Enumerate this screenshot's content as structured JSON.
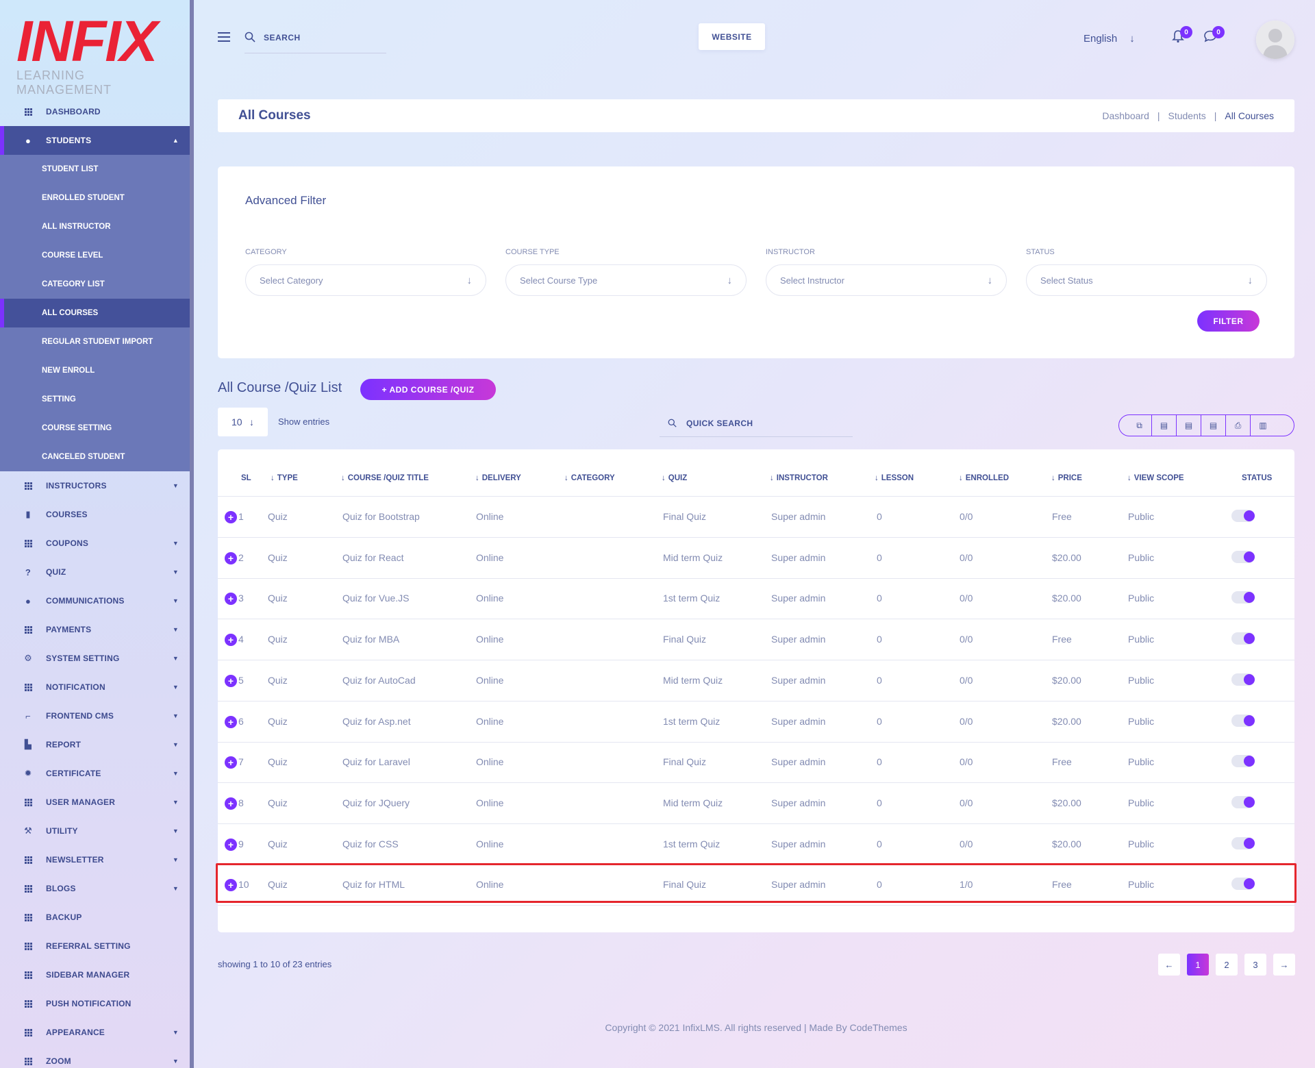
{
  "brand": {
    "logo_text": "INFIX",
    "logo_sub": "LEARNING MANAGEMENT",
    "logo_color": "#ea2235"
  },
  "sidebar": {
    "items_top": [
      {
        "label": "DASHBOARD",
        "icon": "grid-icon"
      },
      {
        "label": "STUDENTS",
        "icon": "user-icon",
        "active": true,
        "expanded": true
      }
    ],
    "submenu": [
      {
        "label": "STUDENT LIST"
      },
      {
        "label": "ENROLLED STUDENT"
      },
      {
        "label": "ALL INSTRUCTOR"
      },
      {
        "label": "COURSE LEVEL"
      },
      {
        "label": "CATEGORY LIST"
      },
      {
        "label": "ALL COURSES",
        "active": true
      },
      {
        "label": "REGULAR STUDENT IMPORT"
      },
      {
        "label": "NEW ENROLL"
      },
      {
        "label": "SETTING"
      },
      {
        "label": "COURSE SETTING"
      },
      {
        "label": "CANCELED STUDENT"
      }
    ],
    "items_bottom": [
      {
        "label": "INSTRUCTORS",
        "icon": "grid-icon",
        "caret": true
      },
      {
        "label": "COURSES",
        "icon": "book-icon",
        "caret": false
      },
      {
        "label": "COUPONS",
        "icon": "grid-icon",
        "caret": true
      },
      {
        "label": "QUIZ",
        "icon": "question-icon",
        "caret": true
      },
      {
        "label": "COMMUNICATIONS",
        "icon": "chat-icon",
        "caret": true
      },
      {
        "label": "PAYMENTS",
        "icon": "grid-icon",
        "caret": true
      },
      {
        "label": "SYSTEM SETTING",
        "icon": "gears-icon",
        "caret": true
      },
      {
        "label": "NOTIFICATION",
        "icon": "grid-icon",
        "caret": true
      },
      {
        "label": "FRONTEND CMS",
        "icon": "paint-roller-icon",
        "caret": true
      },
      {
        "label": "REPORT",
        "icon": "chart-icon",
        "caret": true
      },
      {
        "label": "CERTIFICATE",
        "icon": "certificate-icon",
        "caret": true
      },
      {
        "label": "USER MANAGER",
        "icon": "grid-icon",
        "caret": true
      },
      {
        "label": "UTILITY",
        "icon": "hammer-icon",
        "caret": true
      },
      {
        "label": "NEWSLETTER",
        "icon": "grid-icon",
        "caret": true
      },
      {
        "label": "BLOGS",
        "icon": "grid-icon",
        "caret": true
      },
      {
        "label": "BACKUP",
        "icon": "grid-icon",
        "caret": false
      },
      {
        "label": "REFERRAL SETTING",
        "icon": "grid-icon",
        "caret": false
      },
      {
        "label": "SIDEBAR MANAGER",
        "icon": "grid-icon",
        "caret": false
      },
      {
        "label": "PUSH NOTIFICATION",
        "icon": "grid-icon",
        "caret": false
      },
      {
        "label": "APPEARANCE",
        "icon": "grid-icon",
        "caret": true
      },
      {
        "label": "ZOOM",
        "icon": "grid-icon",
        "caret": true
      }
    ]
  },
  "topbar": {
    "search_placeholder": "SEARCH",
    "website_label": "WEBSITE",
    "language": "English",
    "notifications_count": "0",
    "messages_count": "0"
  },
  "page": {
    "title": "All Courses",
    "breadcrumb": [
      "Dashboard",
      "Students",
      "All Courses"
    ]
  },
  "filter": {
    "title": "Advanced Filter",
    "fields": [
      {
        "label": "CATEGORY",
        "placeholder": "Select Category"
      },
      {
        "label": "COURSE TYPE",
        "placeholder": "Select Course Type"
      },
      {
        "label": "INSTRUCTOR",
        "placeholder": "Select Instructor"
      },
      {
        "label": "STATUS",
        "placeholder": "Select Status"
      }
    ],
    "button": "FILTER"
  },
  "list": {
    "title": "All Course /Quiz List",
    "add_button": "+ ADD COURSE /QUIZ",
    "entries_value": "10",
    "show_entries": "Show entries",
    "quick_search": "QUICK SEARCH",
    "export_icons": [
      "copy-icon",
      "excel-icon",
      "csv-icon",
      "pdf-icon",
      "print-icon",
      "columns-icon"
    ],
    "columns": [
      "SL",
      "TYPE",
      "COURSE /QUIZ TITLE",
      "DELIVERY",
      "CATEGORY",
      "QUIZ",
      "INSTRUCTOR",
      "LESSON",
      "ENROLLED",
      "PRICE",
      "VIEW SCOPE",
      "STATUS"
    ],
    "rows": [
      {
        "sl": "1",
        "type": "Quiz",
        "title": "Quiz for Bootstrap",
        "delivery": "Online",
        "category": "",
        "quiz": "Final Quiz",
        "instructor": "Super admin",
        "lesson": "0",
        "enrolled": "0/0",
        "price": "Free",
        "scope": "Public",
        "status_on": true
      },
      {
        "sl": "2",
        "type": "Quiz",
        "title": "Quiz for React",
        "delivery": "Online",
        "category": "",
        "quiz": "Mid term Quiz",
        "instructor": "Super admin",
        "lesson": "0",
        "enrolled": "0/0",
        "price": "$20.00",
        "scope": "Public",
        "status_on": true
      },
      {
        "sl": "3",
        "type": "Quiz",
        "title": "Quiz for Vue.JS",
        "delivery": "Online",
        "category": "",
        "quiz": "1st term Quiz",
        "instructor": "Super admin",
        "lesson": "0",
        "enrolled": "0/0",
        "price": "$20.00",
        "scope": "Public",
        "status_on": true
      },
      {
        "sl": "4",
        "type": "Quiz",
        "title": "Quiz for MBA",
        "delivery": "Online",
        "category": "",
        "quiz": "Final Quiz",
        "instructor": "Super admin",
        "lesson": "0",
        "enrolled": "0/0",
        "price": "Free",
        "scope": "Public",
        "status_on": true
      },
      {
        "sl": "5",
        "type": "Quiz",
        "title": "Quiz for AutoCad",
        "delivery": "Online",
        "category": "",
        "quiz": "Mid term Quiz",
        "instructor": "Super admin",
        "lesson": "0",
        "enrolled": "0/0",
        "price": "$20.00",
        "scope": "Public",
        "status_on": true
      },
      {
        "sl": "6",
        "type": "Quiz",
        "title": "Quiz for Asp.net",
        "delivery": "Online",
        "category": "",
        "quiz": "1st term Quiz",
        "instructor": "Super admin",
        "lesson": "0",
        "enrolled": "0/0",
        "price": "$20.00",
        "scope": "Public",
        "status_on": true
      },
      {
        "sl": "7",
        "type": "Quiz",
        "title": "Quiz for Laravel",
        "delivery": "Online",
        "category": "",
        "quiz": "Final Quiz",
        "instructor": "Super admin",
        "lesson": "0",
        "enrolled": "0/0",
        "price": "Free",
        "scope": "Public",
        "status_on": true
      },
      {
        "sl": "8",
        "type": "Quiz",
        "title": "Quiz for JQuery",
        "delivery": "Online",
        "category": "",
        "quiz": "Mid term Quiz",
        "instructor": "Super admin",
        "lesson": "0",
        "enrolled": "0/0",
        "price": "$20.00",
        "scope": "Public",
        "status_on": true
      },
      {
        "sl": "9",
        "type": "Quiz",
        "title": "Quiz for CSS",
        "delivery": "Online",
        "category": "",
        "quiz": "1st term Quiz",
        "instructor": "Super admin",
        "lesson": "0",
        "enrolled": "0/0",
        "price": "$20.00",
        "scope": "Public",
        "status_on": true
      },
      {
        "sl": "10",
        "type": "Quiz",
        "title": "Quiz for HTML",
        "delivery": "Online",
        "category": "",
        "quiz": "Final Quiz",
        "instructor": "Super admin",
        "lesson": "0",
        "enrolled": "1/0",
        "price": "Free",
        "scope": "Public",
        "status_on": true,
        "highlighted": true
      }
    ],
    "showing": "showing 1 to 10 of 23 entries",
    "pages": [
      "1",
      "2",
      "3"
    ],
    "current_page": "1"
  },
  "footer": {
    "text": "Copyright © 2021 InfixLMS. All rights reserved | Made By CodeThemes"
  },
  "colors": {
    "accent": "#7c32ff",
    "accent2": "#c738d8",
    "text": "#415094",
    "muted": "#828bb2",
    "highlight": "#e5262d"
  }
}
